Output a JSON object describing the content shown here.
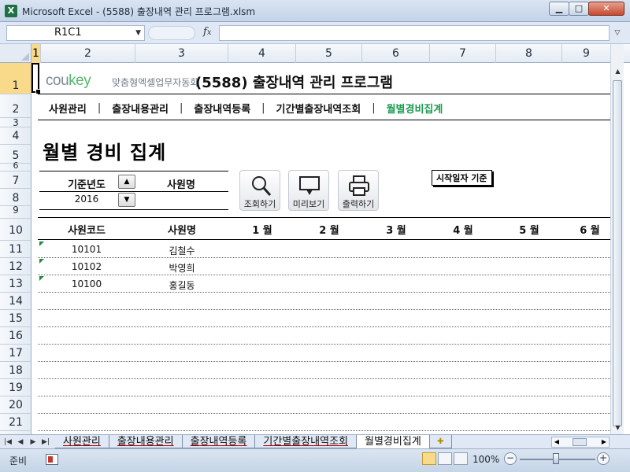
{
  "window": {
    "title": "Microsoft Excel - (5588) 출장내역 관리 프로그램.xlsm",
    "icon": "excel-icon"
  },
  "formula_bar": {
    "name_box": "R1C1",
    "fx": "fx",
    "formula": ""
  },
  "columns": [
    "1",
    "2",
    "3",
    "4",
    "5",
    "6",
    "7",
    "8",
    "9"
  ],
  "rows": [
    "1",
    "2",
    "3",
    "4",
    "5",
    "6",
    "7",
    "8",
    "9",
    "10",
    "11",
    "12",
    "13",
    "14",
    "15",
    "16",
    "17",
    "18",
    "19",
    "20",
    "21"
  ],
  "header": {
    "logo_main": "cou",
    "logo_accent": "key",
    "logo_sub": "맞춤형엑셀업무자동화",
    "program_title": "(5588) 출장내역 관리 프로그램"
  },
  "menu": {
    "items": [
      "사원관리",
      "출장내용관리",
      "출장내역등록",
      "기간별출장내역조회",
      "월별경비집계"
    ],
    "separator": "|",
    "active_index": 4
  },
  "page": {
    "title": "월별 경비 집계",
    "filter_year_label": "기준년도",
    "filter_year_value": "2016",
    "filter_employee_label": "사원명",
    "filter_employee_value": "",
    "basis_note": "시작일자 기준"
  },
  "toolbar": {
    "search_label": "조회하기",
    "preview_label": "미리보기",
    "print_label": "출력하기"
  },
  "table": {
    "headers": [
      "사원코드",
      "사원명",
      "1 월",
      "2 월",
      "3 월",
      "4 월",
      "5 월",
      "6 월"
    ],
    "rows": [
      {
        "code": "10101",
        "name": "김철수"
      },
      {
        "code": "10102",
        "name": "박영희"
      },
      {
        "code": "10100",
        "name": "홍길동"
      }
    ]
  },
  "sheet_tabs": {
    "tabs": [
      "사원관리",
      "출장내용관리",
      "출장내역등록",
      "기간별출장내역조회",
      "월별경비집계"
    ],
    "active_index": 4,
    "insert_icon": "insert-sheet-icon"
  },
  "status_bar": {
    "status": "준비",
    "zoom": "100%",
    "zoom_out": "−",
    "zoom_in": "+"
  },
  "colors": {
    "accent_green": "#1a9c4f",
    "selection_header": "#f9d98a",
    "title_bar": "#c3d3e8"
  }
}
